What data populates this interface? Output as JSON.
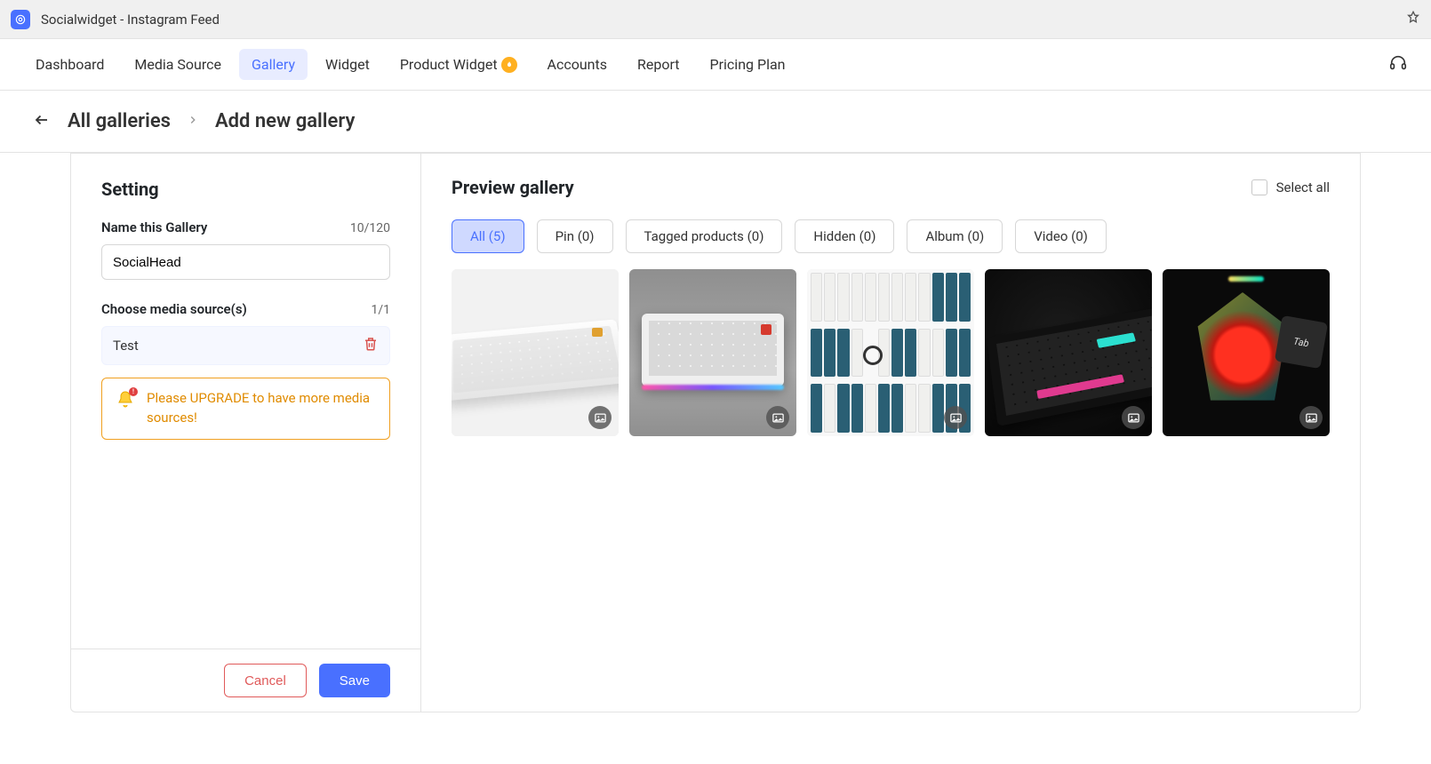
{
  "app": {
    "title": "Socialwidget - Instagram Feed"
  },
  "nav": {
    "dashboard": "Dashboard",
    "media_source": "Media Source",
    "gallery": "Gallery",
    "widget": "Widget",
    "product_widget": "Product Widget",
    "accounts": "Accounts",
    "report": "Report",
    "pricing_plan": "Pricing Plan"
  },
  "breadcrumb": {
    "back": "All galleries",
    "current": "Add new gallery"
  },
  "settings": {
    "heading": "Setting",
    "name_label": "Name this Gallery",
    "name_counter": "10/120",
    "name_value": "SocialHead",
    "source_label": "Choose media source(s)",
    "source_counter": "1/1",
    "source_value": "Test",
    "upgrade_msg": "Please UPGRADE to have more media sources!",
    "cancel": "Cancel",
    "save": "Save"
  },
  "preview": {
    "heading": "Preview gallery",
    "select_all": "Select all",
    "tabs": {
      "all": "All (5)",
      "pin": "Pin (0)",
      "tagged": "Tagged products (0)",
      "hidden": "Hidden (0)",
      "album": "Album (0)",
      "video": "Video (0)"
    },
    "thumb5_tab": "Tab"
  }
}
